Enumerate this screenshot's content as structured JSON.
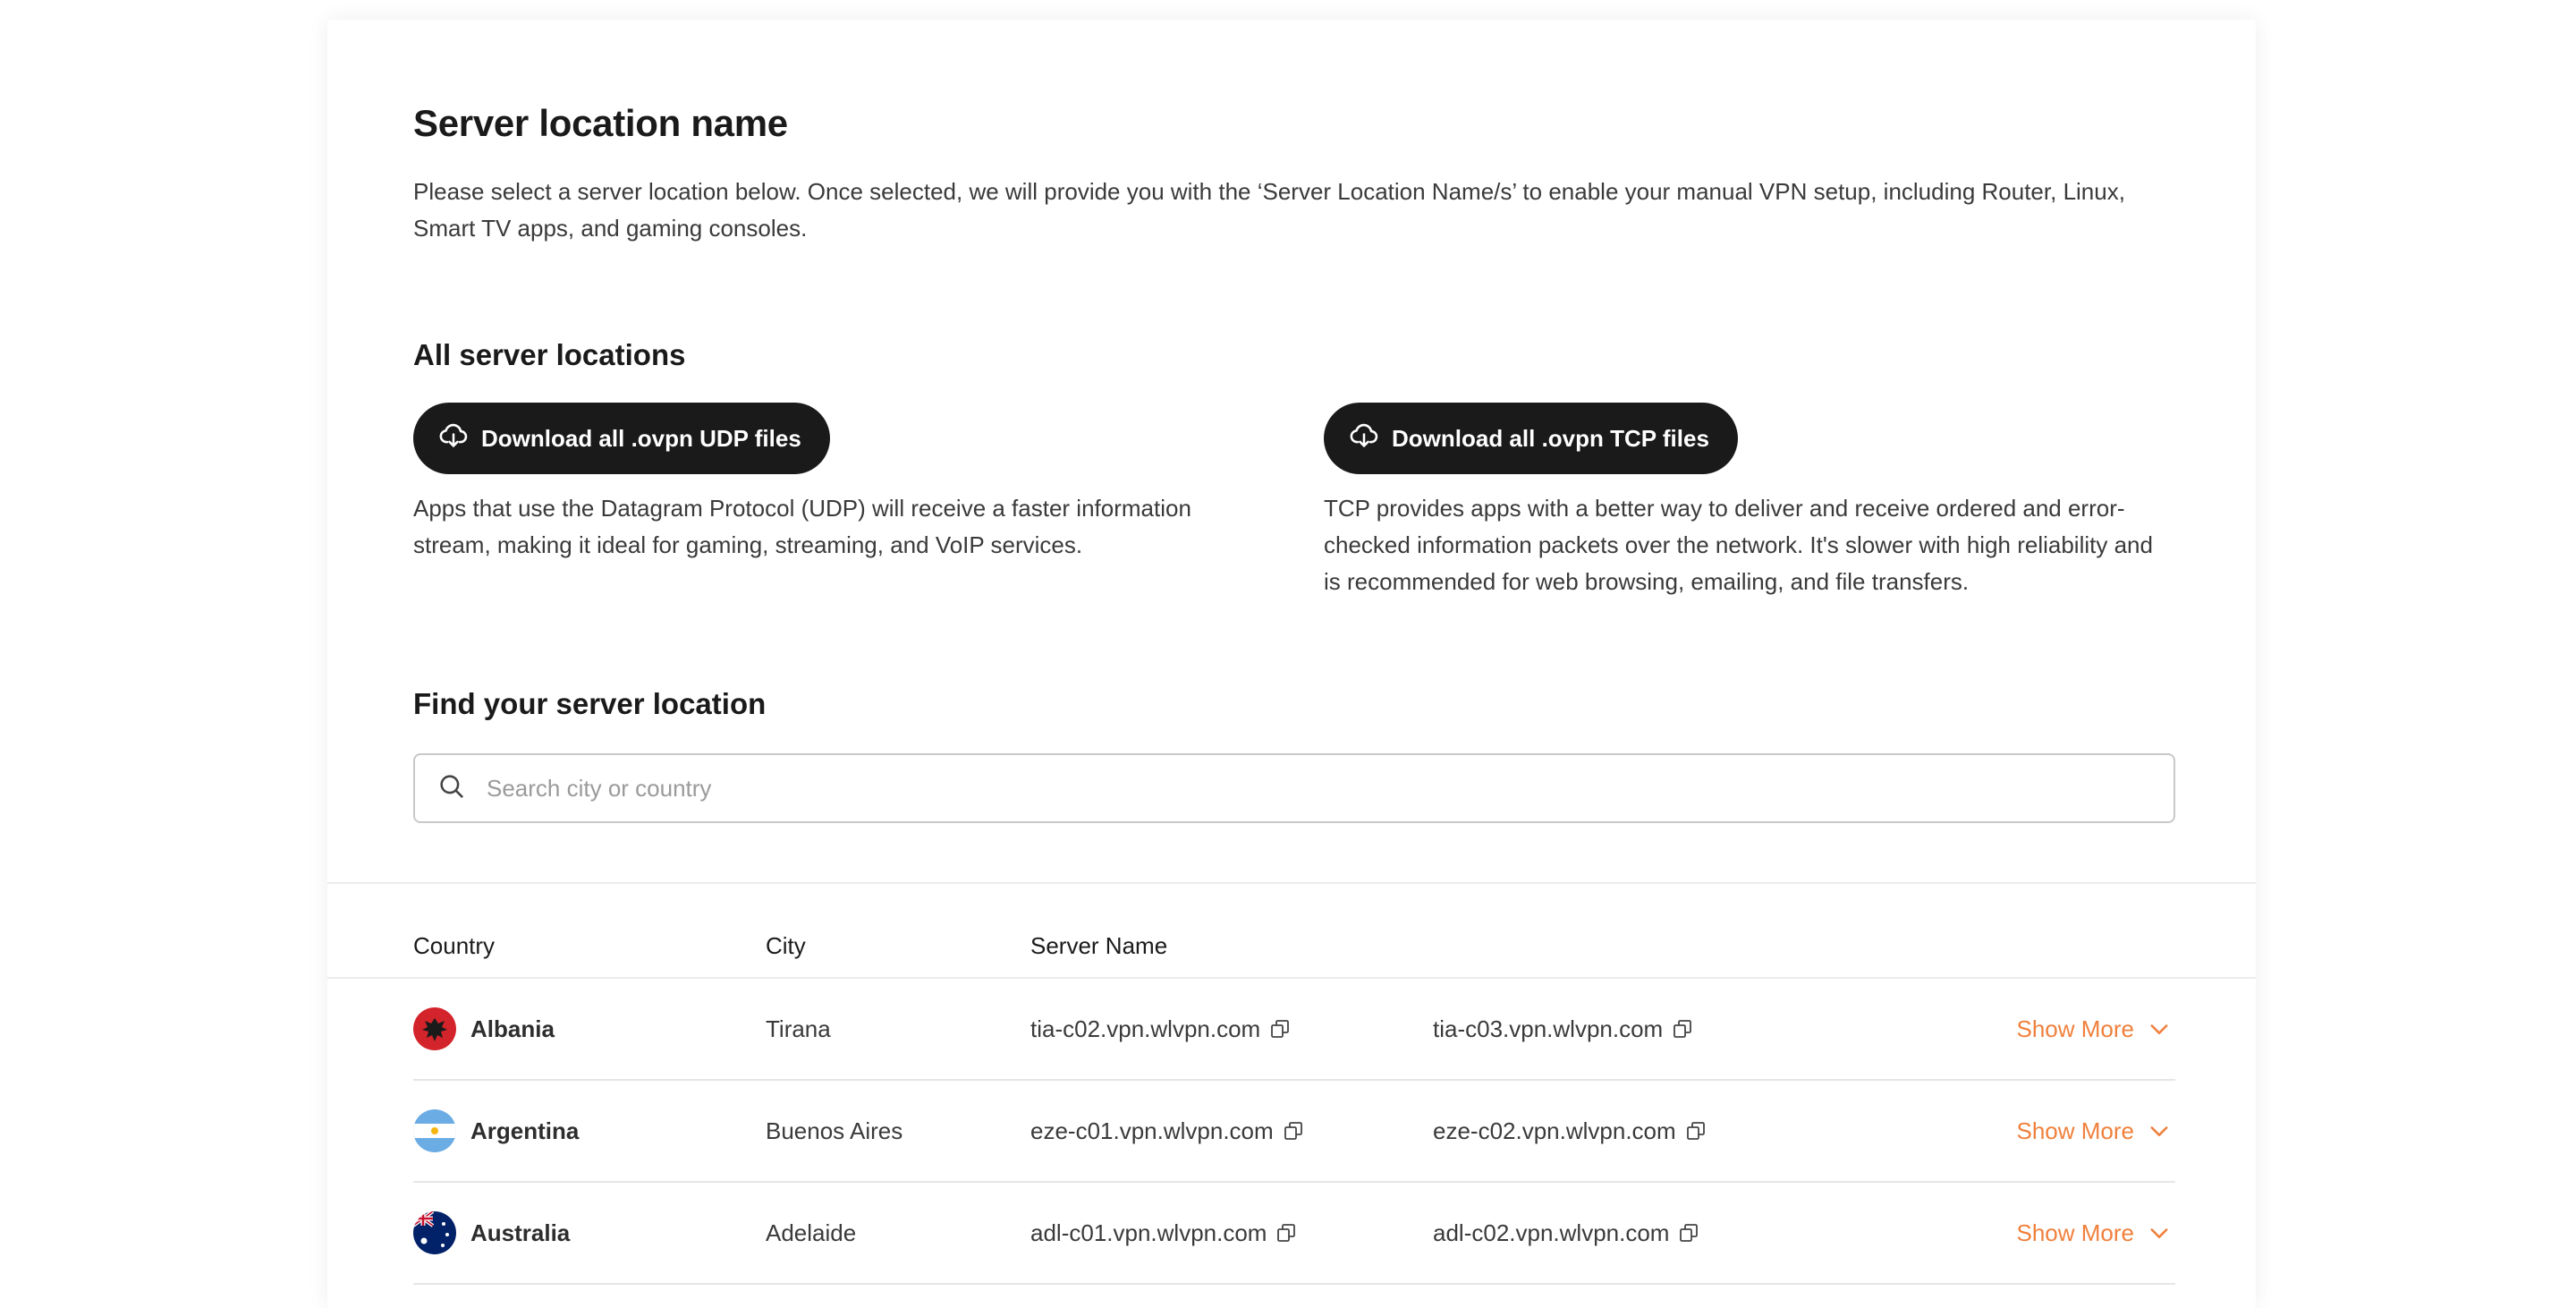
{
  "page": {
    "title": "Server location name",
    "intro": "Please select a server location below. Once selected, we will provide you with the ‘Server Location Name/s’ to enable your manual VPN setup, including Router, Linux, Smart TV apps, and gaming consoles."
  },
  "downloads": {
    "heading": "All server locations",
    "udp": {
      "label": "Download all .ovpn UDP files",
      "description": "Apps that use the Datagram Protocol (UDP) will receive a faster information stream, making it ideal for gaming, streaming, and VoIP services."
    },
    "tcp": {
      "label": "Download all .ovpn TCP files",
      "description": "TCP provides apps with a better way to deliver and receive ordered and error-checked information packets over the network. It's slower with high reliability and is recommended for web browsing, emailing, and file transfers."
    }
  },
  "search": {
    "heading": "Find your server location",
    "placeholder": "Search city or country",
    "value": ""
  },
  "table": {
    "headers": [
      "Country",
      "City",
      "Server Name"
    ],
    "show_more_label": "Show More",
    "rows": [
      {
        "country": "Albania",
        "city": "Tirana",
        "server1": "tia-c02.vpn.wlvpn.com",
        "server2": "tia-c03.vpn.wlvpn.com"
      },
      {
        "country": "Argentina",
        "city": "Buenos Aires",
        "server1": "eze-c01.vpn.wlvpn.com",
        "server2": "eze-c02.vpn.wlvpn.com"
      },
      {
        "country": "Australia",
        "city": "Adelaide",
        "server1": "adl-c01.vpn.wlvpn.com",
        "server2": "adl-c02.vpn.wlvpn.com"
      }
    ]
  },
  "colors": {
    "accent": "#f0803c",
    "button_bg": "#1a1a1a"
  },
  "icons": [
    "cloud-download-icon",
    "search-icon",
    "copy-icon",
    "chevron-down-icon",
    "flag-albania-icon",
    "flag-argentina-icon",
    "flag-australia-icon"
  ]
}
